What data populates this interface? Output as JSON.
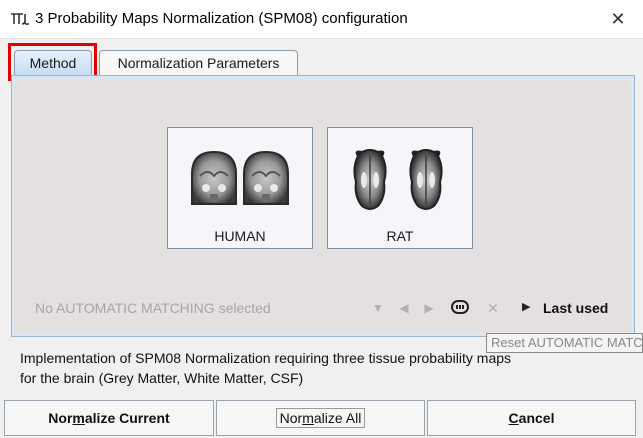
{
  "window": {
    "title": "3 Probability Maps Normalization (SPM08) configuration",
    "icon": "pmod-logo-icon",
    "close_glyph": "✕"
  },
  "tabs": [
    {
      "label": "Method",
      "selected": true
    },
    {
      "label": "Normalization Parameters",
      "selected": false
    }
  ],
  "species": [
    {
      "label": "HUMAN"
    },
    {
      "label": "RAT"
    }
  ],
  "matching": {
    "status": "No AUTOMATIC MATCHING selected",
    "last_used": "Last used",
    "tooltip": "Reset AUTOMATIC MATCHING"
  },
  "description": {
    "line1": "Implementation of SPM08 Normalization requiring three tissue probability maps",
    "line2": "for the brain (Grey Matter, White Matter, CSF)"
  },
  "buttons": {
    "normalize_current": {
      "pre": "Nor",
      "mnemonic": "m",
      "post": "alize Current"
    },
    "normalize_all": {
      "pre": "Nor",
      "mnemonic": "m",
      "post": "alize All"
    },
    "cancel": {
      "pre": "",
      "mnemonic": "C",
      "post": "ancel"
    }
  },
  "colors": {
    "highlight": "#e00000",
    "selected_tab": "#c5dcf5",
    "panel_border": "#9fb3cc"
  }
}
